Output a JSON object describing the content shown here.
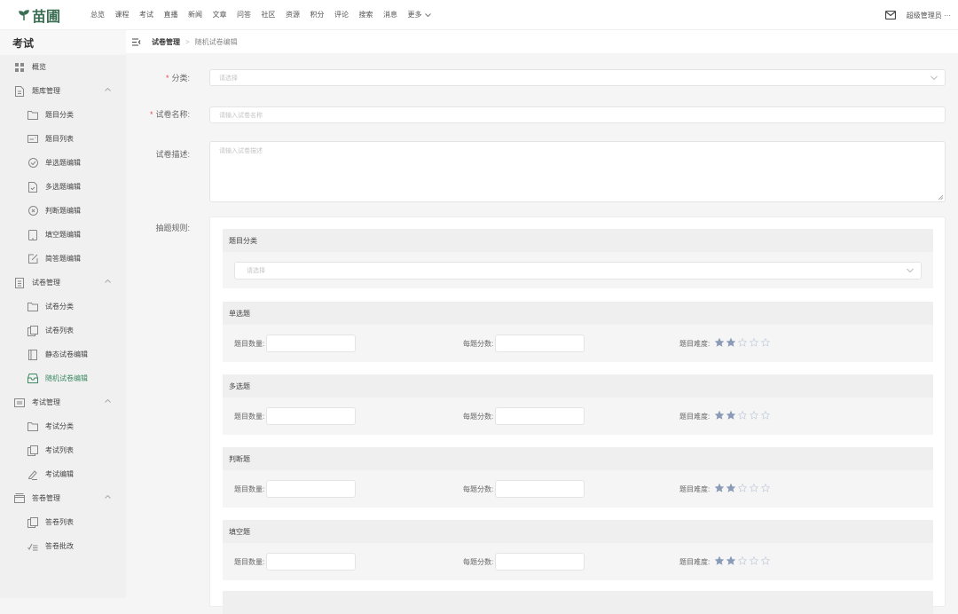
{
  "brand": {
    "name": "苗圃",
    "color": "#3c6e53"
  },
  "top_nav": [
    "总览",
    "课程",
    "考试",
    "直播",
    "新闻",
    "文章",
    "问答",
    "社区",
    "资源",
    "积分",
    "评论",
    "搜索",
    "消息"
  ],
  "top_nav_more": "更多",
  "user": {
    "name": "超级管理员",
    "more": "···"
  },
  "sidebar": {
    "title": "考试",
    "items": [
      {
        "label": "概览",
        "icon": "grid-icon",
        "level": 1
      },
      {
        "label": "题库管理",
        "icon": "document-icon",
        "level": 1,
        "expanded": true
      },
      {
        "label": "题目分类",
        "icon": "folder-icon",
        "level": 2
      },
      {
        "label": "题目列表",
        "icon": "list-card-icon",
        "level": 2
      },
      {
        "label": "单选题编辑",
        "icon": "check-circle-icon",
        "level": 2
      },
      {
        "label": "多选题编辑",
        "icon": "file-check-icon",
        "level": 2
      },
      {
        "label": "判断题编辑",
        "icon": "close-circle-icon",
        "level": 2
      },
      {
        "label": "填空题编辑",
        "icon": "tablet-icon",
        "level": 2
      },
      {
        "label": "简答题编辑",
        "icon": "edit-square-icon",
        "level": 2
      },
      {
        "label": "试卷管理",
        "icon": "paper-icon",
        "level": 1,
        "expanded": true
      },
      {
        "label": "试卷分类",
        "icon": "folder-icon",
        "level": 2
      },
      {
        "label": "试卷列表",
        "icon": "copy-icon",
        "level": 2
      },
      {
        "label": "静态试卷编辑",
        "icon": "book-icon",
        "level": 2
      },
      {
        "label": "随机试卷编辑",
        "icon": "inbox-icon",
        "level": 2,
        "active": true
      },
      {
        "label": "考试管理",
        "icon": "calendar-icon",
        "level": 1,
        "expanded": true
      },
      {
        "label": "考试分类",
        "icon": "folder-icon",
        "level": 2
      },
      {
        "label": "考试列表",
        "icon": "copy-icon",
        "level": 2
      },
      {
        "label": "考试编辑",
        "icon": "pen-icon",
        "level": 2
      },
      {
        "label": "答卷管理",
        "icon": "box-icon",
        "level": 1,
        "expanded": true
      },
      {
        "label": "答卷列表",
        "icon": "copy-icon",
        "level": 2
      },
      {
        "label": "答卷批改",
        "icon": "check-list-icon",
        "level": 2
      }
    ],
    "active_color": "#3c8a63"
  },
  "breadcrumb": {
    "parent": "试卷管理",
    "current": "随机试卷编辑"
  },
  "form": {
    "category": {
      "label": "分类:",
      "placeholder": "请选择",
      "required": true
    },
    "name": {
      "label": "试卷名称:",
      "placeholder": "请输入试卷名称",
      "required": true
    },
    "description": {
      "label": "试卷描述:",
      "placeholder": "请输入试卷描述"
    },
    "rules_label": "抽题规则:"
  },
  "rules": {
    "category": {
      "title": "题目分类",
      "placeholder": "请选择"
    },
    "sections": [
      {
        "title": "单选题",
        "count_label": "题目数量:",
        "score_label": "每题分数:",
        "difficulty_label": "题目难度:",
        "difficulty": 2,
        "max": 5
      },
      {
        "title": "多选题",
        "count_label": "题目数量:",
        "score_label": "每题分数:",
        "difficulty_label": "题目难度:",
        "difficulty": 2,
        "max": 5
      },
      {
        "title": "判断题",
        "count_label": "题目数量:",
        "score_label": "每题分数:",
        "difficulty_label": "题目难度:",
        "difficulty": 2,
        "max": 5
      },
      {
        "title": "填空题",
        "count_label": "题目数量:",
        "score_label": "每题分数:",
        "difficulty_label": "题目难度:",
        "difficulty": 2,
        "max": 5
      }
    ],
    "star_color": "#8a9bb8"
  }
}
